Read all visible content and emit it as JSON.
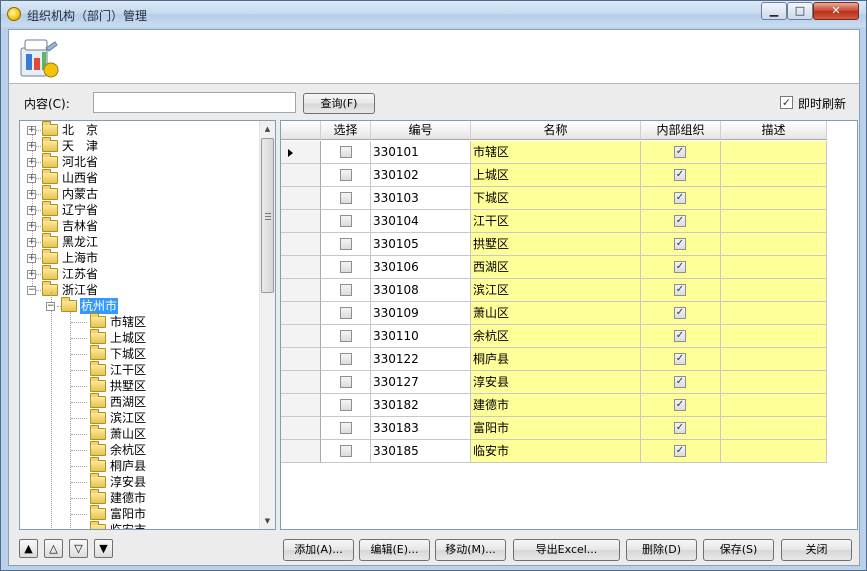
{
  "window": {
    "title": "组织机构（部门）管理",
    "min_glyph": "▁",
    "max_glyph": "□",
    "close_glyph": "✕"
  },
  "search": {
    "label": "内容(C):",
    "value": "",
    "placeholder": "",
    "button": "查询(F)"
  },
  "refresh": {
    "label": "即时刷新",
    "checked": true,
    "check_glyph": "✓"
  },
  "tree": {
    "expanded_glyph": "−",
    "collapsed_glyph": "+",
    "provinces": [
      "北　京",
      "天　津",
      "河北省",
      "山西省",
      "内蒙古",
      "辽宁省",
      "吉林省",
      "黑龙江",
      "上海市",
      "江苏省",
      "浙江省"
    ],
    "city": "杭州市",
    "districts": [
      "市辖区",
      "上城区",
      "下城区",
      "江干区",
      "拱墅区",
      "西湖区",
      "滨江区",
      "萧山区",
      "余杭区",
      "桐庐县",
      "淳安县",
      "建德市",
      "富阳市",
      "临安市"
    ]
  },
  "nav_buttons": [
    "▲",
    "△",
    "▽",
    "▼"
  ],
  "grid": {
    "columns": [
      "选择",
      "编号",
      "名称",
      "内部组织",
      "描述"
    ],
    "rows": [
      {
        "code": "330101",
        "name": "市辖区",
        "selected": false,
        "internal": true,
        "desc": ""
      },
      {
        "code": "330102",
        "name": "上城区",
        "selected": false,
        "internal": true,
        "desc": ""
      },
      {
        "code": "330103",
        "name": "下城区",
        "selected": false,
        "internal": true,
        "desc": ""
      },
      {
        "code": "330104",
        "name": "江干区",
        "selected": false,
        "internal": true,
        "desc": ""
      },
      {
        "code": "330105",
        "name": "拱墅区",
        "selected": false,
        "internal": true,
        "desc": ""
      },
      {
        "code": "330106",
        "name": "西湖区",
        "selected": false,
        "internal": true,
        "desc": ""
      },
      {
        "code": "330108",
        "name": "滨江区",
        "selected": false,
        "internal": true,
        "desc": ""
      },
      {
        "code": "330109",
        "name": "萧山区",
        "selected": false,
        "internal": true,
        "desc": ""
      },
      {
        "code": "330110",
        "name": "余杭区",
        "selected": false,
        "internal": true,
        "desc": ""
      },
      {
        "code": "330122",
        "name": "桐庐县",
        "selected": false,
        "internal": true,
        "desc": ""
      },
      {
        "code": "330127",
        "name": "淳安县",
        "selected": false,
        "internal": true,
        "desc": ""
      },
      {
        "code": "330182",
        "name": "建德市",
        "selected": false,
        "internal": true,
        "desc": ""
      },
      {
        "code": "330183",
        "name": "富阳市",
        "selected": false,
        "internal": true,
        "desc": ""
      },
      {
        "code": "330185",
        "name": "临安市",
        "selected": false,
        "internal": true,
        "desc": ""
      }
    ]
  },
  "buttons": {
    "add": "添加(A)...",
    "edit": "编辑(E)...",
    "move": "移动(M)...",
    "export": "导出Excel...",
    "delete": "删除(D)",
    "save": "保存(S)",
    "close": "关闭"
  },
  "colors": {
    "name_cell": "#ffff99",
    "selection": "#3399ff"
  }
}
